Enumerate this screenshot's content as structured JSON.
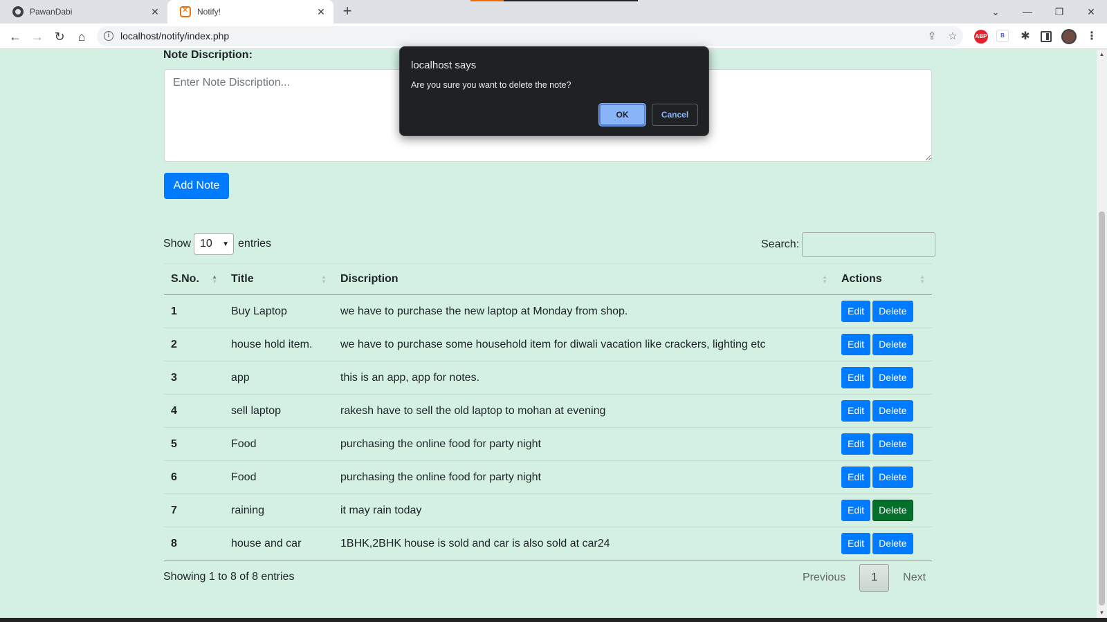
{
  "browser": {
    "tabs": [
      {
        "title": "PawanDabi",
        "icon": "github-icon",
        "active": false
      },
      {
        "title": "Notify!",
        "icon": "xampp-icon",
        "active": true
      }
    ],
    "url": "localhost/notify/index.php"
  },
  "form": {
    "description_label": "Note Discription:",
    "description_placeholder": "Enter Note Discription...",
    "add_button": "Add Note"
  },
  "datatable": {
    "show_label": "Show",
    "entries_label": "entries",
    "page_length": "10",
    "search_label": "Search:",
    "columns": [
      "S.No.",
      "Title",
      "Discription",
      "Actions"
    ],
    "rows": [
      {
        "sno": "1",
        "title": "Buy Laptop",
        "description": "we have to purchase the new laptop at Monday from shop."
      },
      {
        "sno": "2",
        "title": "house hold item.",
        "description": "we have to purchase some household item for diwali vacation like crackers, lighting etc"
      },
      {
        "sno": "3",
        "title": "app",
        "description": "this is an app, app for notes."
      },
      {
        "sno": "4",
        "title": "sell laptop",
        "description": "rakesh have to sell the old laptop to mohan at evening"
      },
      {
        "sno": "5",
        "title": "Food",
        "description": "purchasing the online food for party night"
      },
      {
        "sno": "6",
        "title": "Food",
        "description": "purchasing the online food for party night"
      },
      {
        "sno": "7",
        "title": "raining",
        "description": "it may rain today"
      },
      {
        "sno": "8",
        "title": "house and car",
        "description": "1BHK,2BHK house is sold and car is also sold at car24"
      }
    ],
    "edit_label": "Edit",
    "delete_label": "Delete",
    "info": "Showing 1 to 8 of 8 entries",
    "pagination": {
      "previous": "Previous",
      "current": "1",
      "next": "Next"
    }
  },
  "dialog": {
    "title": "localhost says",
    "message": "Are you sure you want to delete the note?",
    "ok": "OK",
    "cancel": "Cancel"
  },
  "colors": {
    "page_background": "#d3f0e3",
    "primary": "#007bff",
    "hover_delete": "#05702c"
  }
}
